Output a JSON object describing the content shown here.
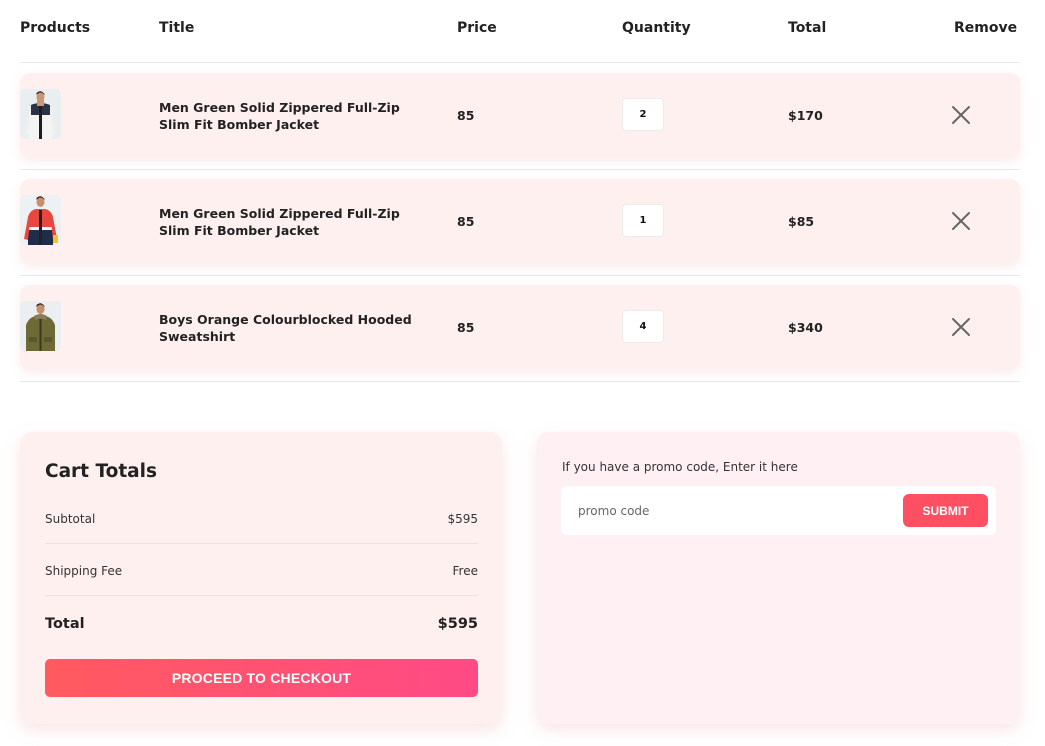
{
  "columns": {
    "products": "Products",
    "title": "Title",
    "price": "Price",
    "quantity": "Quantity",
    "total": "Total",
    "remove": "Remove"
  },
  "items": [
    {
      "title": "Men Green Solid Zippered Full-Zip Slim Fit Bomber Jacket",
      "price": "85",
      "quantity": "2",
      "total": "$170",
      "remove_icon": "close-icon",
      "thumb_icon": "jacket-photo-white"
    },
    {
      "title": "Men Green Solid Zippered Full-Zip Slim Fit Bomber Jacket",
      "price": "85",
      "quantity": "1",
      "total": "$85",
      "remove_icon": "close-icon",
      "thumb_icon": "jacket-photo-red"
    },
    {
      "title": "Boys Orange Colourblocked Hooded Sweatshirt",
      "price": "85",
      "quantity": "4",
      "total": "$340",
      "remove_icon": "close-icon",
      "thumb_icon": "jacket-photo-olive"
    }
  ],
  "cart_totals": {
    "heading": "Cart Totals",
    "subtotal_label": "Subtotal",
    "subtotal_value": "$595",
    "shipping_label": "Shipping Fee",
    "shipping_value": "Free",
    "total_label": "Total",
    "total_value": "$595",
    "checkout_label": "PROCEED TO CHECKOUT"
  },
  "promo": {
    "label": "If you have a promo code, Enter it here",
    "placeholder": "promo code",
    "submit_label": "SUBMIT"
  },
  "colors": {
    "row_background": "#fff0f0",
    "accent": "#ff5063",
    "checkout_gradient_start": "#ff5a5f",
    "checkout_gradient_end": "#ff4a86"
  }
}
